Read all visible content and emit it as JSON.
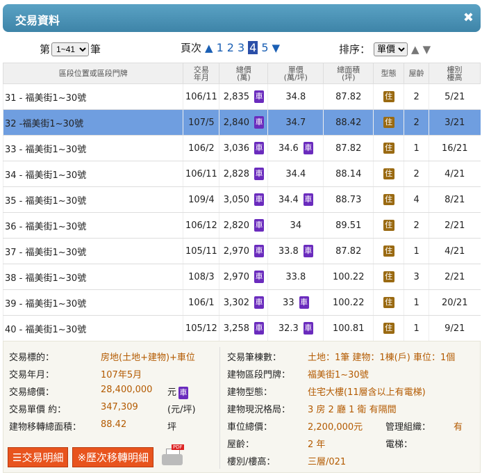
{
  "window": {
    "title": "交易資料",
    "close": "✖"
  },
  "pager": {
    "prefix": "第",
    "suffix": "筆",
    "range": "1~41",
    "page_label": "頁次",
    "pages": [
      "1",
      "2",
      "3",
      "4",
      "5"
    ],
    "active_page": "4",
    "prev": "▲",
    "next": "▼"
  },
  "sort": {
    "label": "排序：",
    "value": "單價",
    "up": "▲",
    "down": "▼"
  },
  "table": {
    "headers": [
      "區段位置或區段門牌",
      "交易\n年月",
      "總價\n(萬)",
      "單價\n(萬/坪)",
      "總面積\n(坪)",
      "型態",
      "屋齡",
      "樓別\n樓高"
    ],
    "rows": [
      {
        "loc": "31 - 福美街1~30號",
        "ym": "106/11",
        "total": "2,835",
        "tcar": true,
        "unit": "34.8",
        "ucar": false,
        "area": "87.82",
        "type": "住",
        "age": "2",
        "floor": "5/21"
      },
      {
        "loc": "32 -福美街1~30號",
        "ym": "107/5",
        "total": "2,840",
        "tcar": true,
        "unit": "34.7",
        "ucar": false,
        "area": "88.42",
        "type": "住",
        "age": "2",
        "floor": "3/21",
        "selected": true
      },
      {
        "loc": "33 - 福美街1~30號",
        "ym": "106/2",
        "total": "3,036",
        "tcar": true,
        "unit": "34.6",
        "ucar": true,
        "area": "87.82",
        "type": "住",
        "age": "1",
        "floor": "16/21"
      },
      {
        "loc": "34 - 福美街1~30號",
        "ym": "106/11",
        "total": "2,828",
        "tcar": true,
        "unit": "34.4",
        "ucar": false,
        "area": "88.14",
        "type": "住",
        "age": "2",
        "floor": "4/21"
      },
      {
        "loc": "35 - 福美街1~30號",
        "ym": "109/4",
        "total": "3,050",
        "tcar": true,
        "unit": "34.4",
        "ucar": true,
        "area": "88.73",
        "type": "住",
        "age": "4",
        "floor": "8/21"
      },
      {
        "loc": "36 - 福美街1~30號",
        "ym": "106/12",
        "total": "2,820",
        "tcar": true,
        "unit": "34",
        "ucar": false,
        "area": "89.51",
        "type": "住",
        "age": "2",
        "floor": "2/21"
      },
      {
        "loc": "37 - 福美街1~30號",
        "ym": "105/11",
        "total": "2,970",
        "tcar": true,
        "unit": "33.8",
        "ucar": true,
        "area": "87.82",
        "type": "住",
        "age": "1",
        "floor": "4/21"
      },
      {
        "loc": "38 - 福美街1~30號",
        "ym": "108/3",
        "total": "2,970",
        "tcar": true,
        "unit": "33.8",
        "ucar": false,
        "area": "100.22",
        "type": "住",
        "age": "3",
        "floor": "2/21"
      },
      {
        "loc": "39 - 福美街1~30號",
        "ym": "106/1",
        "total": "3,302",
        "tcar": true,
        "unit": "33",
        "ucar": true,
        "area": "100.22",
        "type": "住",
        "age": "1",
        "floor": "20/21"
      },
      {
        "loc": "40 - 福美街1~30號",
        "ym": "105/12",
        "total": "3,258",
        "tcar": true,
        "unit": "32.3",
        "ucar": true,
        "area": "100.81",
        "type": "住",
        "age": "1",
        "floor": "9/21"
      }
    ],
    "car_label": "車"
  },
  "detail": {
    "left": [
      {
        "k": "交易標的：",
        "v": "房地(土地+建物)+車位",
        "u": ""
      },
      {
        "k": "交易年月：",
        "v": "107年5月",
        "u": ""
      },
      {
        "k": "交易總價：",
        "v": "28,400,000",
        "u": "元"
      },
      {
        "k": "交易單價 約：",
        "v": "347,309",
        "u": "(元/坪)"
      },
      {
        "k": "建物移轉總面積：",
        "v": "88.42",
        "u": "坪"
      }
    ],
    "right": [
      {
        "k": "交易筆棟數：",
        "v": "土地：1筆 建物：1棟(戶) 車位：1個"
      },
      {
        "k": "建物區段門牌：",
        "v": "福美街1~30號"
      },
      {
        "k": "建物型態：",
        "v": "住宅大樓(11層含以上有電梯)"
      },
      {
        "k": "建物現況格局：",
        "v": "3 房 2 廳 1 衛 有隔間"
      },
      {
        "k": "車位總價：",
        "v": "2,200,000元",
        "k2": "管理組織：",
        "v2": "有"
      },
      {
        "k": "屋齡：",
        "v": "2 年",
        "k2": "電梯：",
        "v2": ""
      },
      {
        "k": "樓別/樓高：",
        "v": "三層/021"
      }
    ],
    "btn_detail": "☰交易明細",
    "btn_history": "※歷次移轉明細",
    "pdf_tag": "PDF"
  }
}
